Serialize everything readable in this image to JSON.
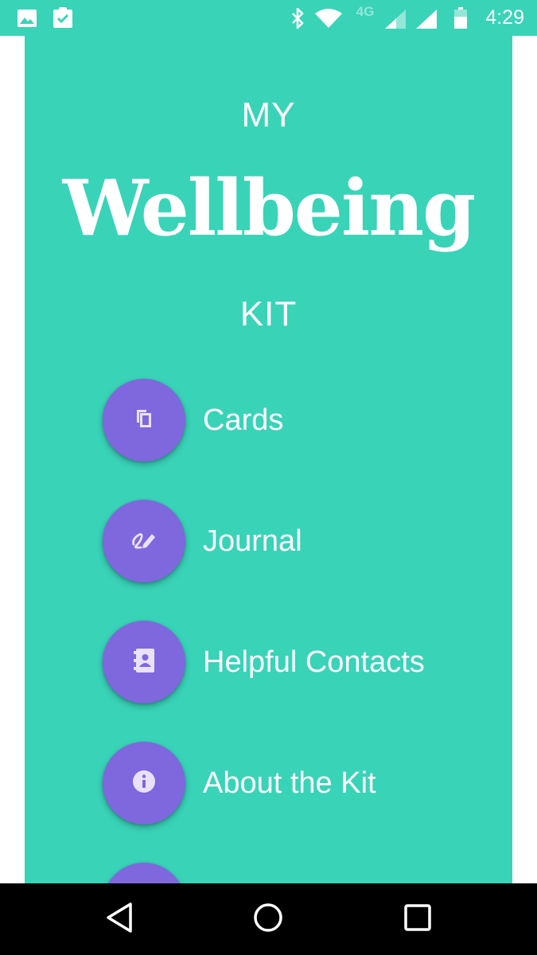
{
  "status_bar": {
    "time": "4:29",
    "network": "4G",
    "icons": [
      "image-icon",
      "clipboard-check-icon",
      "bluetooth-icon",
      "wifi-icon",
      "signal-icon",
      "signal-icon",
      "battery-icon"
    ]
  },
  "header": {
    "line1": "MY",
    "line2": "Wellbeing",
    "line3": "KIT"
  },
  "menu": {
    "items": [
      {
        "label": "Cards",
        "icon": "cards-icon"
      },
      {
        "label": "Journal",
        "icon": "journal-icon"
      },
      {
        "label": "Helpful Contacts",
        "icon": "contacts-icon"
      },
      {
        "label": "About the Kit",
        "icon": "info-icon"
      }
    ]
  },
  "nav_bar": {
    "buttons": [
      "back",
      "home",
      "recents"
    ]
  },
  "colors": {
    "background": "#39d3b8",
    "button": "#7f67de",
    "text": "#ffffff",
    "nav": "#000000"
  }
}
